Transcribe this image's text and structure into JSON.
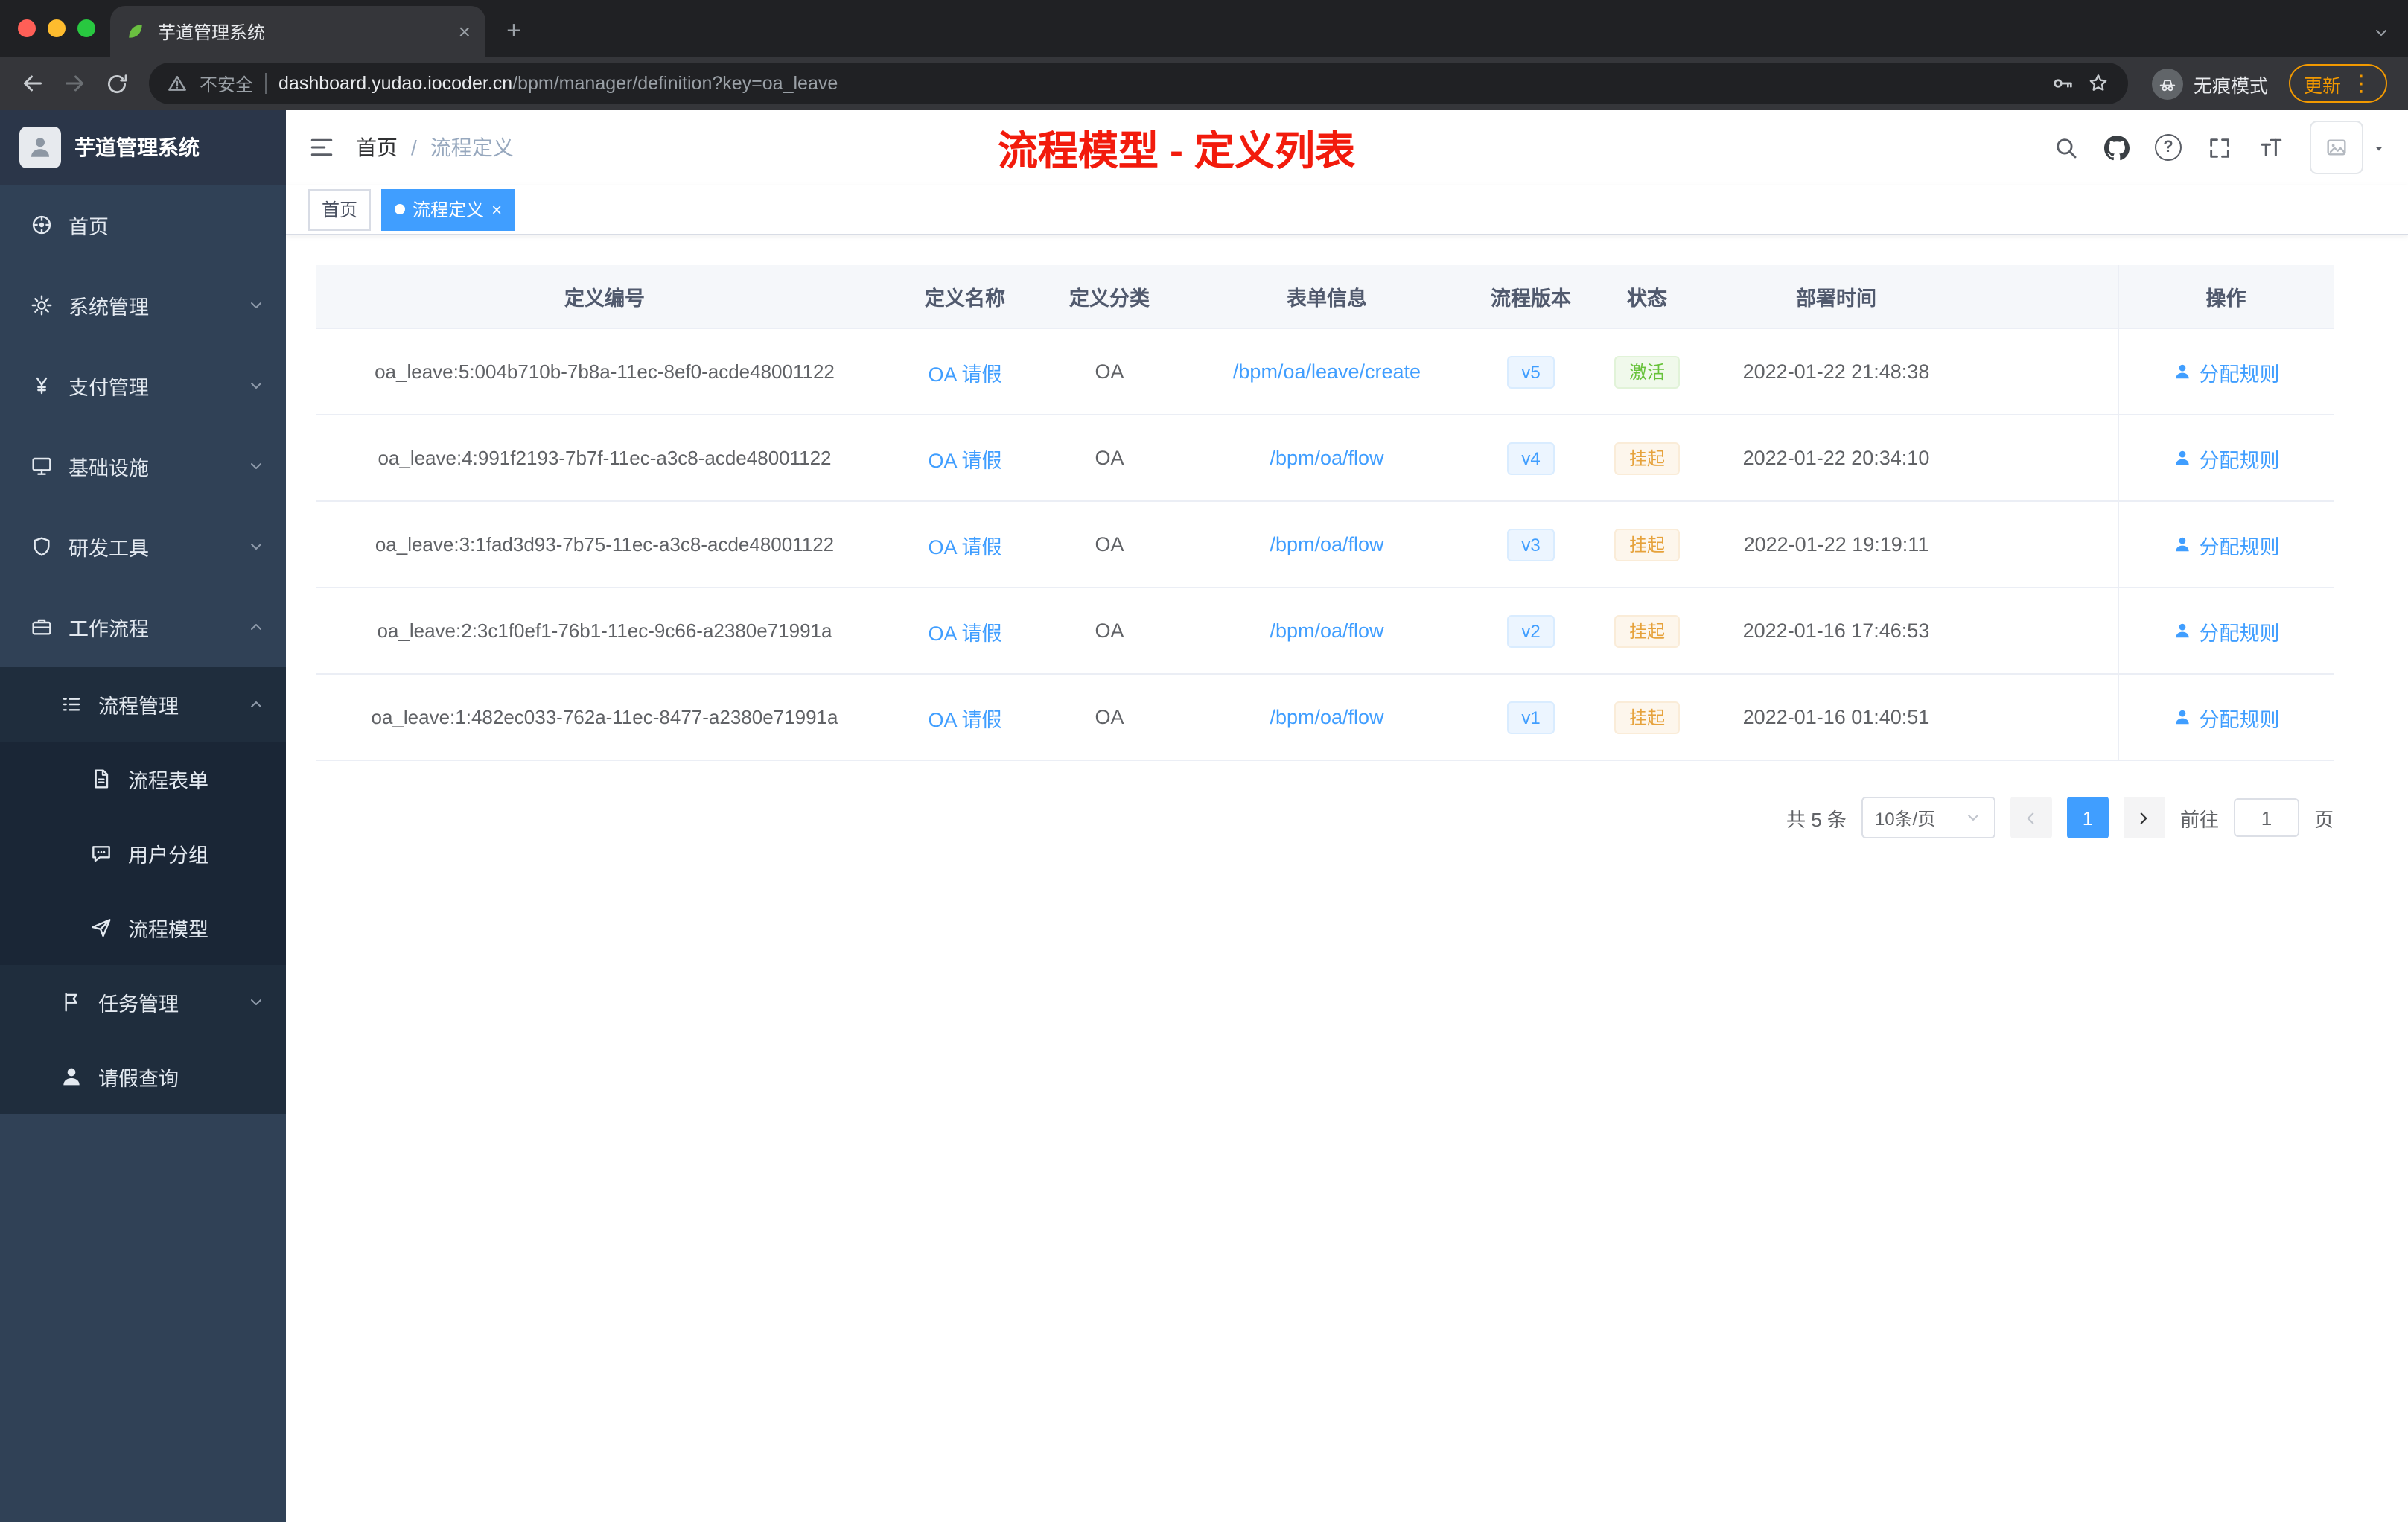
{
  "browser": {
    "tab_title": "芋道管理系统",
    "security_label": "不安全",
    "url_host": "dashboard.yudao.iocoder.cn",
    "url_path": "/bpm/manager/definition?key=oa_leave",
    "incognito_label": "无痕模式",
    "update_label": "更新"
  },
  "icons": {
    "close_glyph": "×",
    "plus_glyph": "+",
    "kebab_glyph": "⋮",
    "help_glyph": "?",
    "names_used": [
      "back-icon",
      "forward-icon",
      "reload-icon",
      "warning-icon",
      "key-icon",
      "star-icon",
      "incognito-icon",
      "search-icon",
      "github-icon",
      "help-icon",
      "fullscreen-icon",
      "font-size-icon",
      "hamburger-icon",
      "dashboard-icon",
      "gear-icon",
      "yen-icon",
      "monitor-icon",
      "shield-icon",
      "briefcase-icon",
      "list-icon",
      "document-icon",
      "chat-icon",
      "paper-plane-icon",
      "flag-icon",
      "user-icon",
      "image-icon",
      "caret-down-icon",
      "chevron-icon",
      "leaf-favicon"
    ]
  },
  "sidebar": {
    "logo_title": "芋道管理系统",
    "items": {
      "home": "首页",
      "system": "系统管理",
      "payment": "支付管理",
      "infra": "基础设施",
      "devtools": "研发工具",
      "workflow": "工作流程",
      "process_mgmt": "流程管理",
      "process_form": "流程表单",
      "user_group": "用户分组",
      "process_model": "流程模型",
      "task_mgmt": "任务管理",
      "leave_query": "请假查询"
    }
  },
  "navbar": {
    "breadcrumb": {
      "home": "首页",
      "separator": "/",
      "current": "流程定义"
    },
    "annotation": "流程模型 - 定义列表"
  },
  "tags": {
    "home": "首页",
    "active": "流程定义"
  },
  "table": {
    "columns": [
      "定义编号",
      "定义名称",
      "定义分类",
      "表单信息",
      "流程版本",
      "状态",
      "部署时间"
    ],
    "action_header": "操作",
    "action_label": "分配规则",
    "rows": [
      {
        "id": "oa_leave:5:004b710b-7b8a-11ec-8ef0-acde48001122",
        "name": "OA 请假",
        "category": "OA",
        "form": "/bpm/oa/leave/create",
        "version": "v5",
        "status": "激活",
        "status_type": "success",
        "time": "2022-01-22 21:48:38"
      },
      {
        "id": "oa_leave:4:991f2193-7b7f-11ec-a3c8-acde48001122",
        "name": "OA 请假",
        "category": "OA",
        "form": "/bpm/oa/flow",
        "version": "v4",
        "status": "挂起",
        "status_type": "warning",
        "time": "2022-01-22 20:34:10"
      },
      {
        "id": "oa_leave:3:1fad3d93-7b75-11ec-a3c8-acde48001122",
        "name": "OA 请假",
        "category": "OA",
        "form": "/bpm/oa/flow",
        "version": "v3",
        "status": "挂起",
        "status_type": "warning",
        "time": "2022-01-22 19:19:11"
      },
      {
        "id": "oa_leave:2:3c1f0ef1-76b1-11ec-9c66-a2380e71991a",
        "name": "OA 请假",
        "category": "OA",
        "form": "/bpm/oa/flow",
        "version": "v2",
        "status": "挂起",
        "status_type": "warning",
        "time": "2022-01-16 17:46:53"
      },
      {
        "id": "oa_leave:1:482ec033-762a-11ec-8477-a2380e71991a",
        "name": "OA 请假",
        "category": "OA",
        "form": "/bpm/oa/flow",
        "version": "v1",
        "status": "挂起",
        "status_type": "warning",
        "time": "2022-01-16 01:40:51"
      }
    ]
  },
  "pagination": {
    "total": "共 5 条",
    "page_size": "10条/页",
    "page": "1",
    "goto_label": "前往",
    "goto_value": "1",
    "goto_suffix": "页"
  },
  "colors": {
    "accent": "#409eff",
    "annotation_red": "#f21b0c",
    "status_active_green": "#67c23a",
    "status_suspend_orange": "#e6a23c",
    "sidebar_bg": "#304156",
    "sidebar_submenu_bg": "#1f2d3d"
  }
}
